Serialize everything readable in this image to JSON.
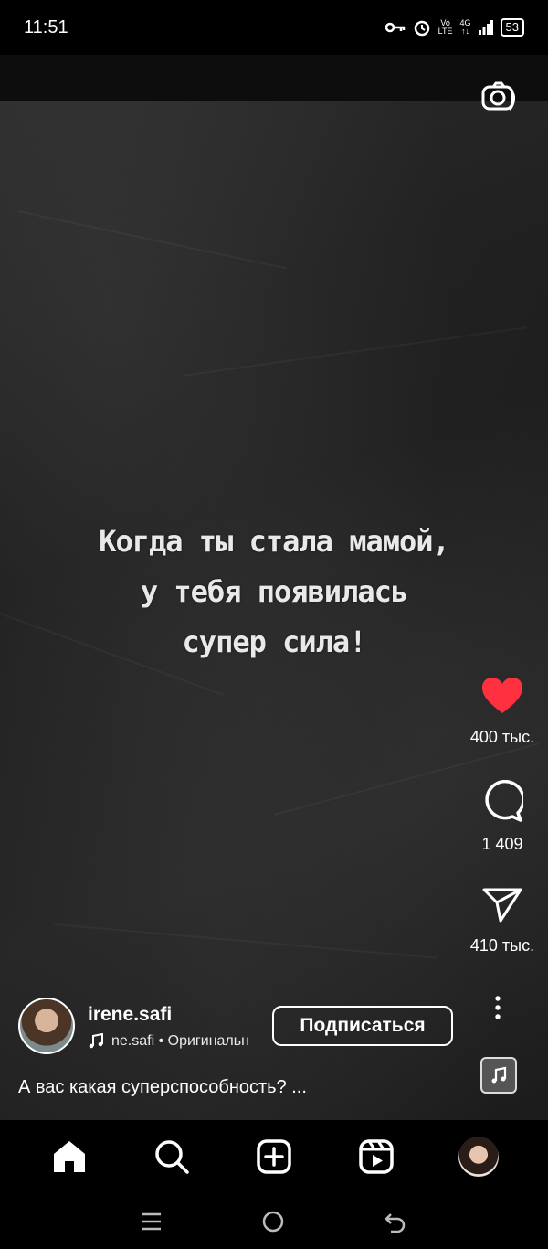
{
  "status_bar": {
    "time": "11:51",
    "network_top": "Vo",
    "network_bottom": "LTE",
    "signal_label": "4G",
    "battery": "53"
  },
  "reel": {
    "overlay_lines": [
      "Когда ты стала мамой,",
      "у тебя появилась",
      "супер сила!"
    ]
  },
  "actions": {
    "like_count": "400 тыс.",
    "comment_count": "1 409",
    "share_count": "410 тыс."
  },
  "author": {
    "username": "irene.safi",
    "audio": "ne.safi • Оригинальн",
    "follow_label": "Подписаться",
    "caption": "А вас какая суперспособность? ..."
  },
  "colors": {
    "like": "#ff3040",
    "background": "#000000"
  },
  "icons": {
    "camera": "camera-icon",
    "like": "heart-icon",
    "comment": "comment-icon",
    "share": "send-icon",
    "more": "more-vertical-icon",
    "home": "home-icon",
    "search": "search-icon",
    "create": "plus-square-icon",
    "reels": "reels-icon"
  }
}
